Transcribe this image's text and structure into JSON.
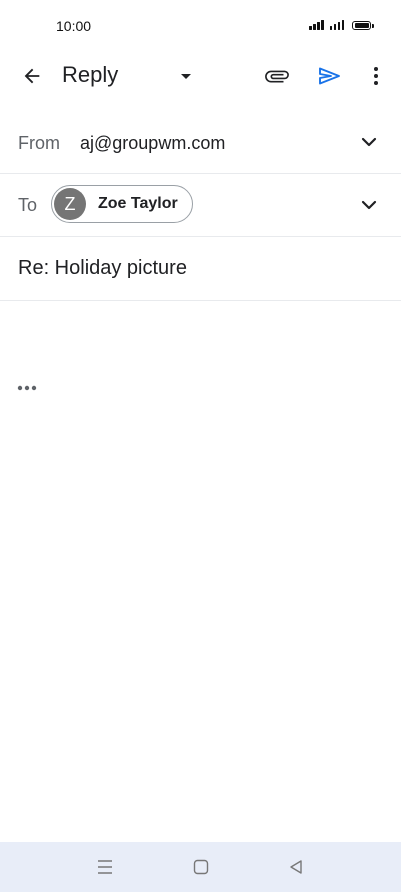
{
  "status_bar": {
    "time": "10:00",
    "icons": [
      "signal-1-icon",
      "signal-2-icon",
      "battery-icon"
    ]
  },
  "app_bar": {
    "title": "Reply",
    "icons": [
      "back-arrow-icon",
      "dropdown-arrow-icon",
      "attach-icon",
      "send-icon",
      "more-vert-icon"
    ],
    "send_color": "#1a73e8"
  },
  "compose": {
    "from_label": "From",
    "from_value": "aj@groupwm.com",
    "to_label": "To",
    "recipient": {
      "initial": "Z",
      "name": "Zoe Taylor"
    },
    "subject": "Re: Holiday picture"
  },
  "nav_bar": {
    "icons": [
      "menu-icon",
      "home-icon",
      "back-icon"
    ]
  }
}
